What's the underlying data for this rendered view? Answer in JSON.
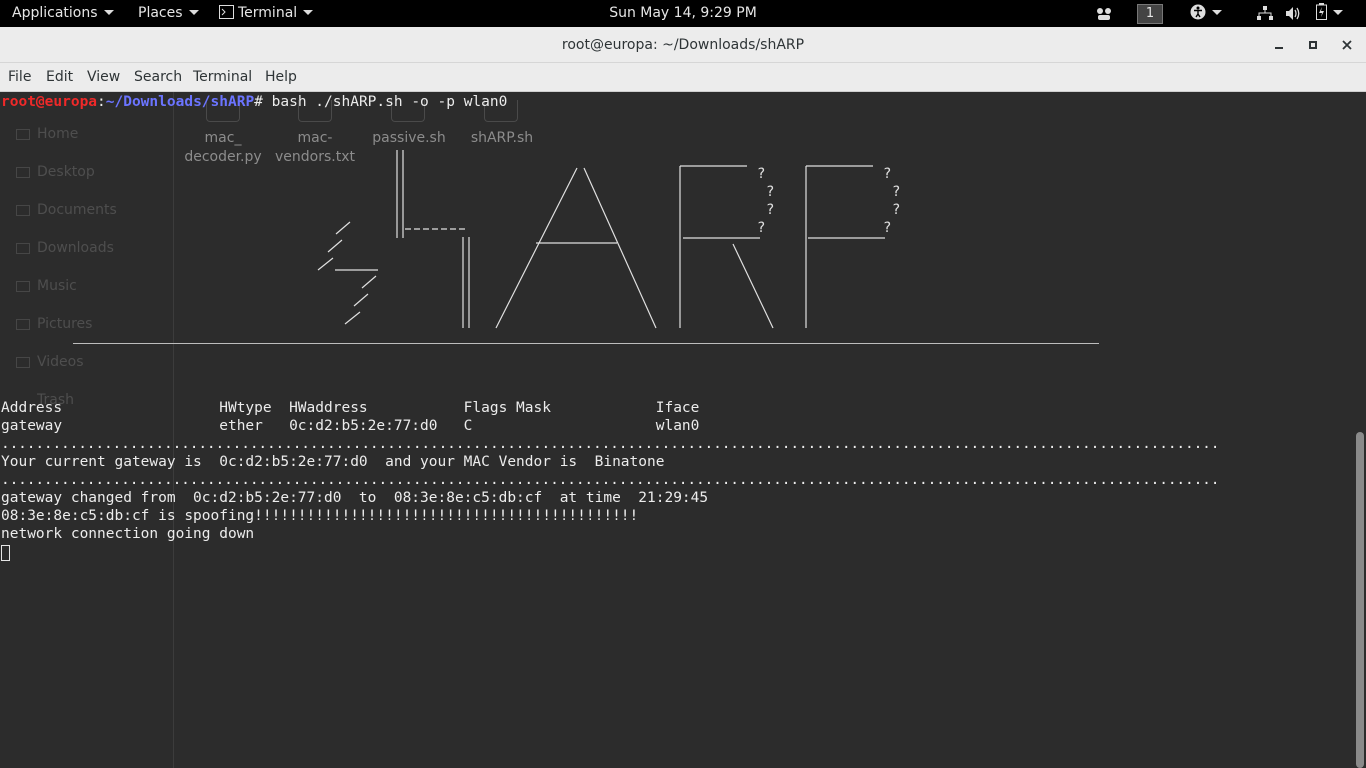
{
  "topbar": {
    "applications": "Applications",
    "places": "Places",
    "terminal": "Terminal",
    "datetime": "Sun May 14,  9:29 PM",
    "workspace": "1",
    "icons": [
      "apps-icon",
      "accessibility-icon",
      "network-icon",
      "volume-icon",
      "battery-icon"
    ]
  },
  "window": {
    "title": "root@europa: ~/Downloads/shARP",
    "buttons": {
      "minimize": "‒",
      "maximize": "▫",
      "close": "✕"
    }
  },
  "menubar": [
    "File",
    "Edit",
    "View",
    "Search",
    "Terminal",
    "Help"
  ],
  "ghost": {
    "sidebar": [
      "Home",
      "Desktop",
      "Documents",
      "Downloads",
      "Music",
      "Pictures",
      "Videos",
      "Trash"
    ],
    "files": [
      [
        "mac_",
        "decoder.py"
      ],
      [
        "mac-",
        "vendors.txt"
      ],
      [
        "passive.sh",
        ""
      ],
      [
        "shARP.sh",
        ""
      ]
    ]
  },
  "terminal": {
    "prompt_user": "root@europa",
    "prompt_sep": ":",
    "prompt_path": "~/Downloads/shARP",
    "prompt_symbol": "# ",
    "command": "bash ./shARP.sh -o -p wlan0",
    "arp_header": "Address                  HWtype  HWaddress           Flags Mask            Iface",
    "arp_row": "gateway                  ether   0c:d2:b5:2e:77:d0   C                     wlan0",
    "dots": "..............................................................................................................................................",
    "gateway_line": "Your current gateway is  0c:d2:b5:2e:77:d0  and your MAC Vendor is  Binatone",
    "changed_line": "gateway changed from  0c:d2:b5:2e:77:d0  to  08:3e:8e:c5:db:cf  at time  21:29:45",
    "spoof_line": "08:3e:8e:c5:db:cf is spoofing!!!!!!!!!!!!!!!!!!!!!!!!!!!!!!!!!!!!!!!!!!!!",
    "down_line": "network connection going down"
  },
  "colors": {
    "background": "#2c2c2c",
    "text": "#ececec",
    "prompt_user": "#ef2929",
    "prompt_path": "#6b74ff"
  }
}
